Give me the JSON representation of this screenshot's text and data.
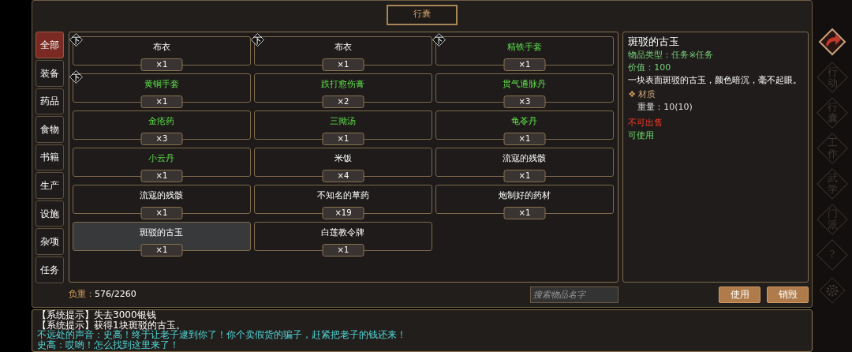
{
  "window": {
    "title": "行囊"
  },
  "categories": [
    {
      "label": "全部",
      "selected": true
    },
    {
      "label": "装备",
      "selected": false
    },
    {
      "label": "药品",
      "selected": false
    },
    {
      "label": "食物",
      "selected": false
    },
    {
      "label": "书籍",
      "selected": false
    },
    {
      "label": "生产",
      "selected": false
    },
    {
      "label": "设施",
      "selected": false
    },
    {
      "label": "杂项",
      "selected": false
    },
    {
      "label": "任务",
      "selected": false
    }
  ],
  "items": [
    {
      "name": "布衣",
      "count": "×1",
      "highlighted": false,
      "tag": "下",
      "selected": false
    },
    {
      "name": "布衣",
      "count": "×1",
      "highlighted": false,
      "tag": "下",
      "selected": false
    },
    {
      "name": "精铁手套",
      "count": "×1",
      "highlighted": true,
      "tag": "下",
      "selected": false
    },
    {
      "name": "黄铜手套",
      "count": "×1",
      "highlighted": true,
      "tag": "下",
      "selected": false
    },
    {
      "name": "跌打愈伤膏",
      "count": "×2",
      "highlighted": true,
      "selected": false
    },
    {
      "name": "贯气通脉丹",
      "count": "×3",
      "highlighted": true,
      "selected": false
    },
    {
      "name": "金疮药",
      "count": "×3",
      "highlighted": true,
      "selected": false
    },
    {
      "name": "三拗汤",
      "count": "×1",
      "highlighted": true,
      "selected": false
    },
    {
      "name": "龟苓丹",
      "count": "×1",
      "highlighted": true,
      "selected": false
    },
    {
      "name": "小云丹",
      "count": "×1",
      "highlighted": true,
      "selected": false
    },
    {
      "name": "米饭",
      "count": "×4",
      "highlighted": false,
      "selected": false
    },
    {
      "name": "流寇的残骸",
      "count": "×1",
      "highlighted": false,
      "selected": false
    },
    {
      "name": "流寇的残骸",
      "count": "×1",
      "highlighted": false,
      "selected": false
    },
    {
      "name": "不知名的草药",
      "count": "×19",
      "highlighted": false,
      "selected": false
    },
    {
      "name": "炮制好的药材",
      "count": "×1",
      "highlighted": false,
      "selected": false
    },
    {
      "name": "斑驳的古玉",
      "count": "×1",
      "highlighted": false,
      "selected": true
    },
    {
      "name": "白莲教令牌",
      "count": "×1",
      "highlighted": false,
      "selected": false
    }
  ],
  "detail": {
    "title": "斑驳的古玉",
    "type": "物品类型：任务※任务",
    "value": "价值：100",
    "description": "一块表面斑驳的古玉，颜色暗沉，毫不起眼。",
    "section_marker": "❖",
    "section": "材质",
    "weight": "重量：10(10)",
    "sell": "不可出售",
    "use": "可使用"
  },
  "weight": {
    "label": "负重：",
    "value": "576/2260"
  },
  "search": {
    "placeholder": "搜索物品名字"
  },
  "buttons": [
    "使用",
    "销毁"
  ],
  "log": [
    {
      "kind": "system",
      "text": "【系统提示】失去3000银钱"
    },
    {
      "kind": "system",
      "text": "【系统提示】获得1块斑驳的古玉。"
    },
    {
      "kind": "speech",
      "text": "不远处的声音：史高！终于让老子逮到你了！你个卖假货的骗子，赶紧把老子的钱还来！"
    },
    {
      "kind": "speech",
      "text": "史高：哎哟！怎么找到这里来了！"
    }
  ],
  "side_menu": [
    {
      "kind": "back"
    },
    {
      "kind": "text",
      "label": "行动"
    },
    {
      "kind": "text",
      "label": "行囊"
    },
    {
      "kind": "text",
      "label": "工作"
    },
    {
      "kind": "text",
      "label": "武学"
    },
    {
      "kind": "text",
      "label": "门派"
    },
    {
      "kind": "text",
      "label": "?"
    },
    {
      "kind": "gear"
    }
  ]
}
